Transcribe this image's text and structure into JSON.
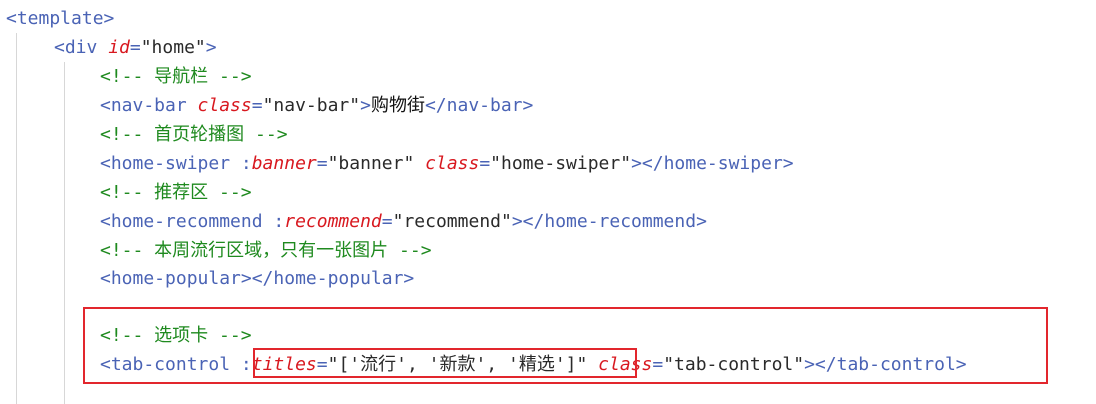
{
  "editor": {
    "lines": [
      {
        "indent": 0,
        "tokens": [
          {
            "t": "tag",
            "v": "<template>"
          }
        ]
      },
      {
        "indent": 1,
        "tokens": [
          {
            "t": "tag",
            "v": "<div "
          },
          {
            "t": "attr",
            "v": "id"
          },
          {
            "t": "eq",
            "v": "="
          },
          {
            "t": "str",
            "v": "\"home\""
          },
          {
            "t": "tag",
            "v": ">"
          }
        ]
      },
      {
        "indent": 2,
        "tokens": [
          {
            "t": "comment",
            "v": "<!-- 导航栏 -->"
          }
        ]
      },
      {
        "indent": 2,
        "tokens": [
          {
            "t": "tag",
            "v": "<nav-bar "
          },
          {
            "t": "attr",
            "v": "class"
          },
          {
            "t": "eq",
            "v": "="
          },
          {
            "t": "str",
            "v": "\"nav-bar\""
          },
          {
            "t": "tag",
            "v": ">"
          },
          {
            "t": "text",
            "v": "购物街"
          },
          {
            "t": "tag",
            "v": "</nav-bar>"
          }
        ]
      },
      {
        "indent": 2,
        "tokens": [
          {
            "t": "comment",
            "v": "<!-- 首页轮播图 -->"
          }
        ]
      },
      {
        "indent": 2,
        "tokens": [
          {
            "t": "tag",
            "v": "<home-swiper :"
          },
          {
            "t": "attr",
            "v": "banner"
          },
          {
            "t": "eq",
            "v": "="
          },
          {
            "t": "str",
            "v": "\"banner\" "
          },
          {
            "t": "attr",
            "v": "class"
          },
          {
            "t": "eq",
            "v": "="
          },
          {
            "t": "str",
            "v": "\"home-swiper\""
          },
          {
            "t": "tag",
            "v": "></home-swiper>"
          }
        ]
      },
      {
        "indent": 2,
        "tokens": [
          {
            "t": "comment",
            "v": "<!-- 推荐区 -->"
          }
        ]
      },
      {
        "indent": 2,
        "tokens": [
          {
            "t": "tag",
            "v": "<home-recommend :"
          },
          {
            "t": "attr",
            "v": "recommend"
          },
          {
            "t": "eq",
            "v": "="
          },
          {
            "t": "str",
            "v": "\"recommend\""
          },
          {
            "t": "tag",
            "v": "></home-recommend>"
          }
        ]
      },
      {
        "indent": 2,
        "tokens": [
          {
            "t": "comment",
            "v": "<!-- 本周流行区域，只有一张图片 -->"
          }
        ]
      },
      {
        "indent": 2,
        "tokens": [
          {
            "t": "tag",
            "v": "<home-popular></home-popular>"
          }
        ]
      },
      {
        "indent": 2,
        "tokens": []
      },
      {
        "indent": 2,
        "tokens": [
          {
            "t": "comment",
            "v": "<!-- 选项卡 -->"
          }
        ]
      },
      {
        "indent": 2,
        "tokens": [
          {
            "t": "tag",
            "v": "<tab-control "
          },
          {
            "t": "tag",
            "v": ":"
          },
          {
            "t": "attr",
            "v": "titles"
          },
          {
            "t": "eq",
            "v": "="
          },
          {
            "t": "str",
            "v": "\"['流行', '新款', '精选']\" "
          },
          {
            "t": "attr",
            "v": "class"
          },
          {
            "t": "eq",
            "v": "="
          },
          {
            "t": "str",
            "v": "\"tab-control\""
          },
          {
            "t": "tag",
            "v": "></tab-control>"
          }
        ]
      }
    ]
  },
  "colors": {
    "tag": "#4a63b5",
    "attribute": "#d8181f",
    "string": "#2a2a2a",
    "comment": "#1f8a1f",
    "highlight_border": "#e2262d"
  }
}
